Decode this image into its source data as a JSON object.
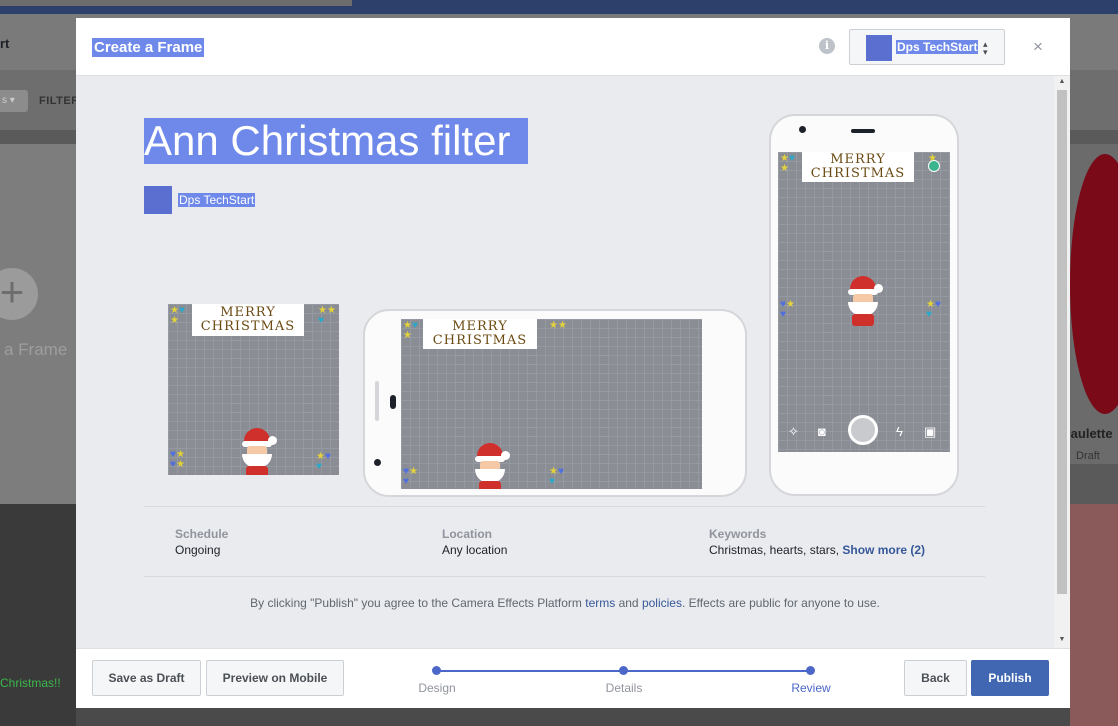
{
  "backdrop": {
    "header_title": "rt",
    "filter_label": "FILTER",
    "filter_pill": "s ▾",
    "create_card_caption": "a Frame",
    "right_card_name": "Paulette",
    "right_card_status": "Draft",
    "left_card_text": "Christmas!!"
  },
  "modal": {
    "title": "Create a Frame",
    "info_icon": "i",
    "page_selector": {
      "name": "Dps TechStart",
      "caret": "▲▼"
    },
    "close_icon": "×"
  },
  "effect": {
    "name": "Ann Christmas filter",
    "owner": "Dps TechStart",
    "banner_line1": "MERRY",
    "banner_line2": "CHRISTMAS"
  },
  "details": {
    "schedule": {
      "label": "Schedule",
      "value": "Ongoing"
    },
    "location": {
      "label": "Location",
      "value": "Any location"
    },
    "keywords": {
      "label": "Keywords",
      "value": "Christmas, hearts, stars,",
      "more": "Show more (2)"
    }
  },
  "disclaimer": {
    "before": "By clicking \"Publish\" you agree to the Camera Effects Platform",
    "terms": "terms",
    "and": "and",
    "policies": "policies",
    "after": ". Effects are public for anyone to use."
  },
  "footer": {
    "save_draft": "Save as Draft",
    "preview_mobile": "Preview on Mobile",
    "steps": [
      "Design",
      "Details",
      "Review"
    ],
    "active_step": "Review",
    "back": "Back",
    "publish": "Publish"
  },
  "colors": {
    "accent": "#4267b2",
    "selection": "#6e89e9",
    "step": "#4b67c9"
  }
}
